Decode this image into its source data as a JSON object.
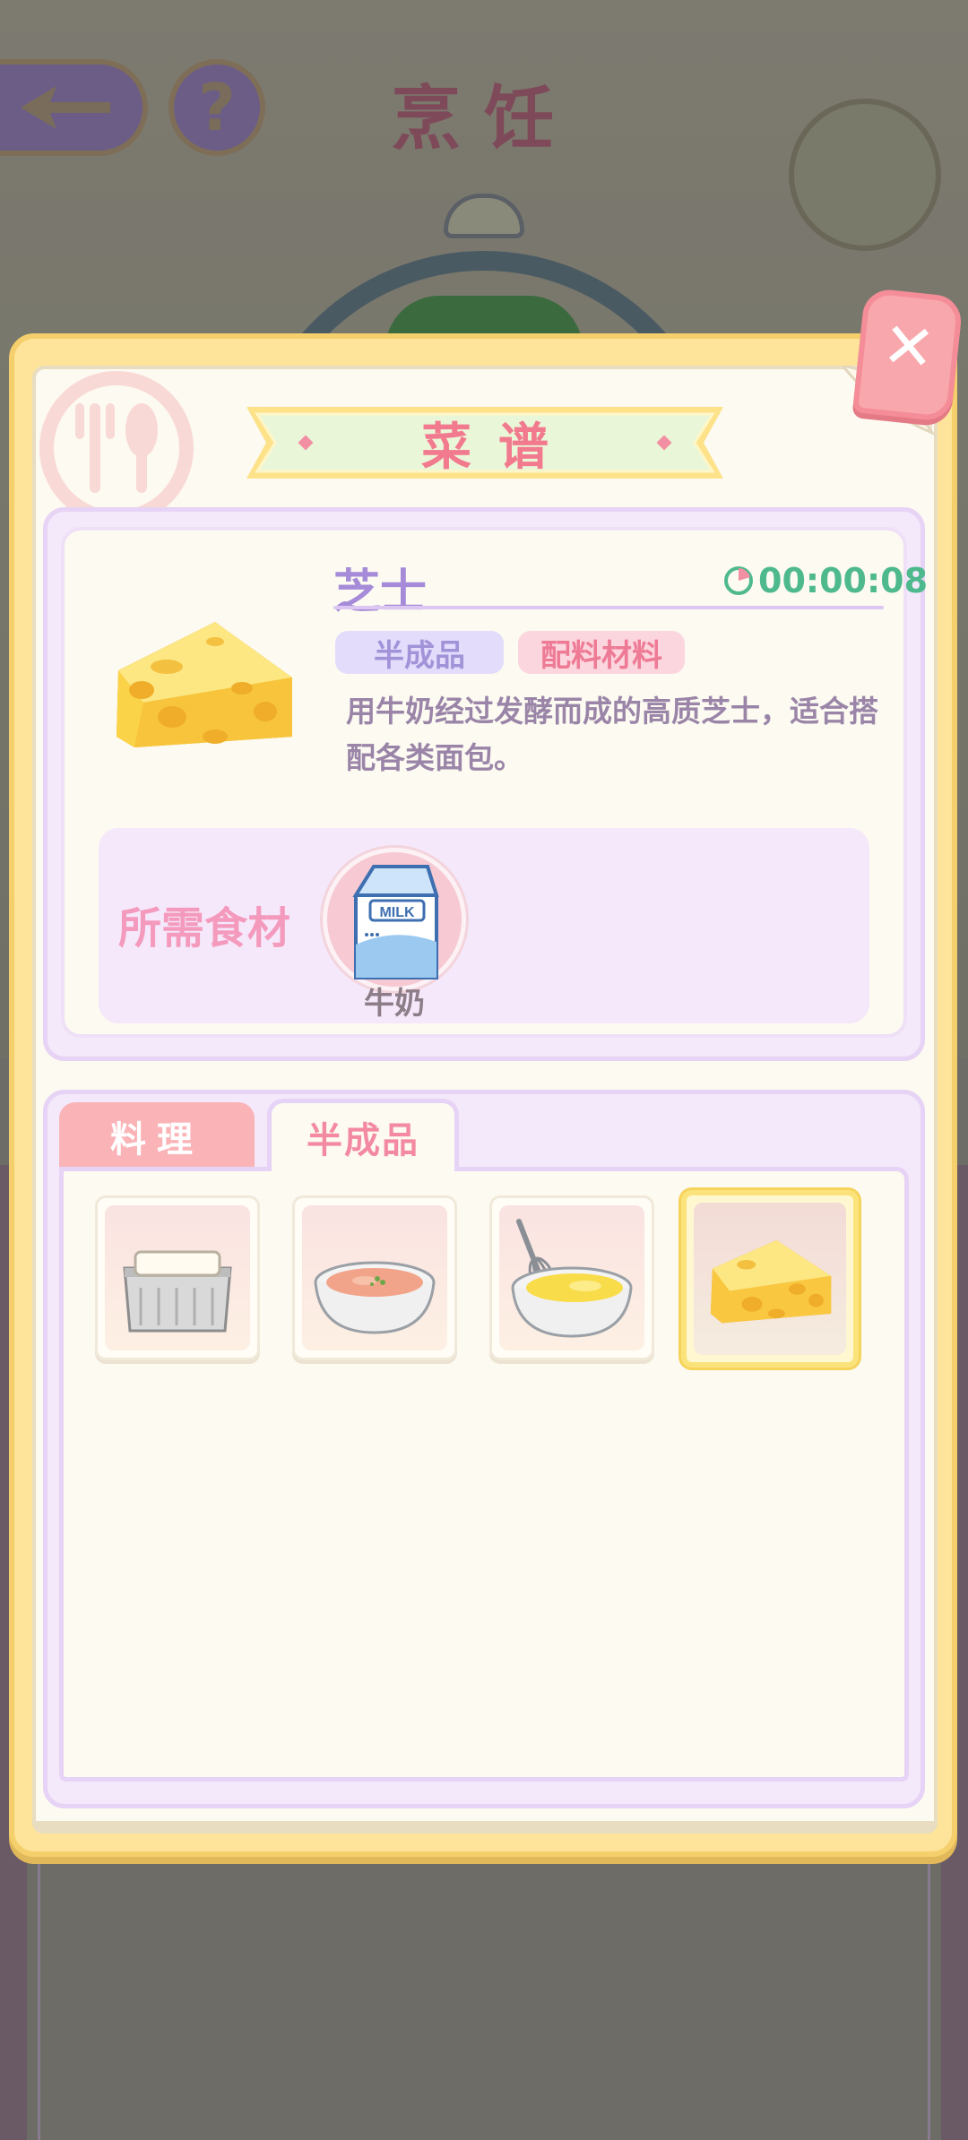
{
  "background": {
    "title": "烹饪",
    "help_symbol": "?"
  },
  "popup": {
    "title": "菜谱",
    "close_symbol": "✕"
  },
  "selected_item": {
    "name": "芝士",
    "timer": "00:00:08",
    "tags": [
      "半成品",
      "配料材料"
    ],
    "description": "用牛奶经过发酵而成的高质芝士，适合搭配各类面包。",
    "ingredients_label": "所需食材",
    "ingredients": [
      {
        "name": "牛奶",
        "icon": "milk-carton-icon"
      }
    ]
  },
  "tabs": [
    {
      "label": "料理",
      "active": false
    },
    {
      "label": "半成品",
      "active": true
    }
  ],
  "recipe_slots": [
    {
      "icon": "tofu-container-icon",
      "selected": false
    },
    {
      "icon": "salmon-bowl-icon",
      "selected": false
    },
    {
      "icon": "whisked-egg-bowl-icon",
      "selected": false
    },
    {
      "icon": "cheese-icon",
      "selected": true
    }
  ],
  "colors": {
    "popup_frame": "#fde49a",
    "title_pink": "#f27a8e",
    "name_purple": "#a58bd8",
    "timer_green": "#4fb98e",
    "selected_border": "#fbe37c"
  }
}
